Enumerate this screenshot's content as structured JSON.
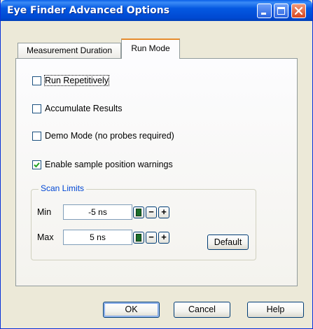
{
  "window": {
    "title": "Eye Finder Advanced Options",
    "controls": {
      "minimize": "minimize",
      "maximize": "maximize",
      "close": "close"
    }
  },
  "tabs": [
    {
      "label": "Measurement Duration",
      "selected": false
    },
    {
      "label": "Run Mode",
      "selected": true
    }
  ],
  "options": [
    {
      "label": "Run Repetitively",
      "checked": false
    },
    {
      "label": "Accumulate Results",
      "checked": false
    },
    {
      "label": "Demo Mode (no probes required)",
      "checked": false
    },
    {
      "label": "Enable sample position warnings",
      "checked": true
    }
  ],
  "scan_limits": {
    "title": "Scan Limits",
    "min": {
      "label": "Min",
      "value": "-5 ns"
    },
    "max": {
      "label": "Max",
      "value": "5 ns"
    },
    "minus_label": "−",
    "plus_label": "+",
    "default_button": "Default"
  },
  "buttons": {
    "ok": "OK",
    "cancel": "Cancel",
    "help": "Help"
  },
  "colors": {
    "titlebar": "#0054E3",
    "dialog_bg": "#ECE9D8",
    "group_title": "#0046D5",
    "check": "#21A121"
  }
}
